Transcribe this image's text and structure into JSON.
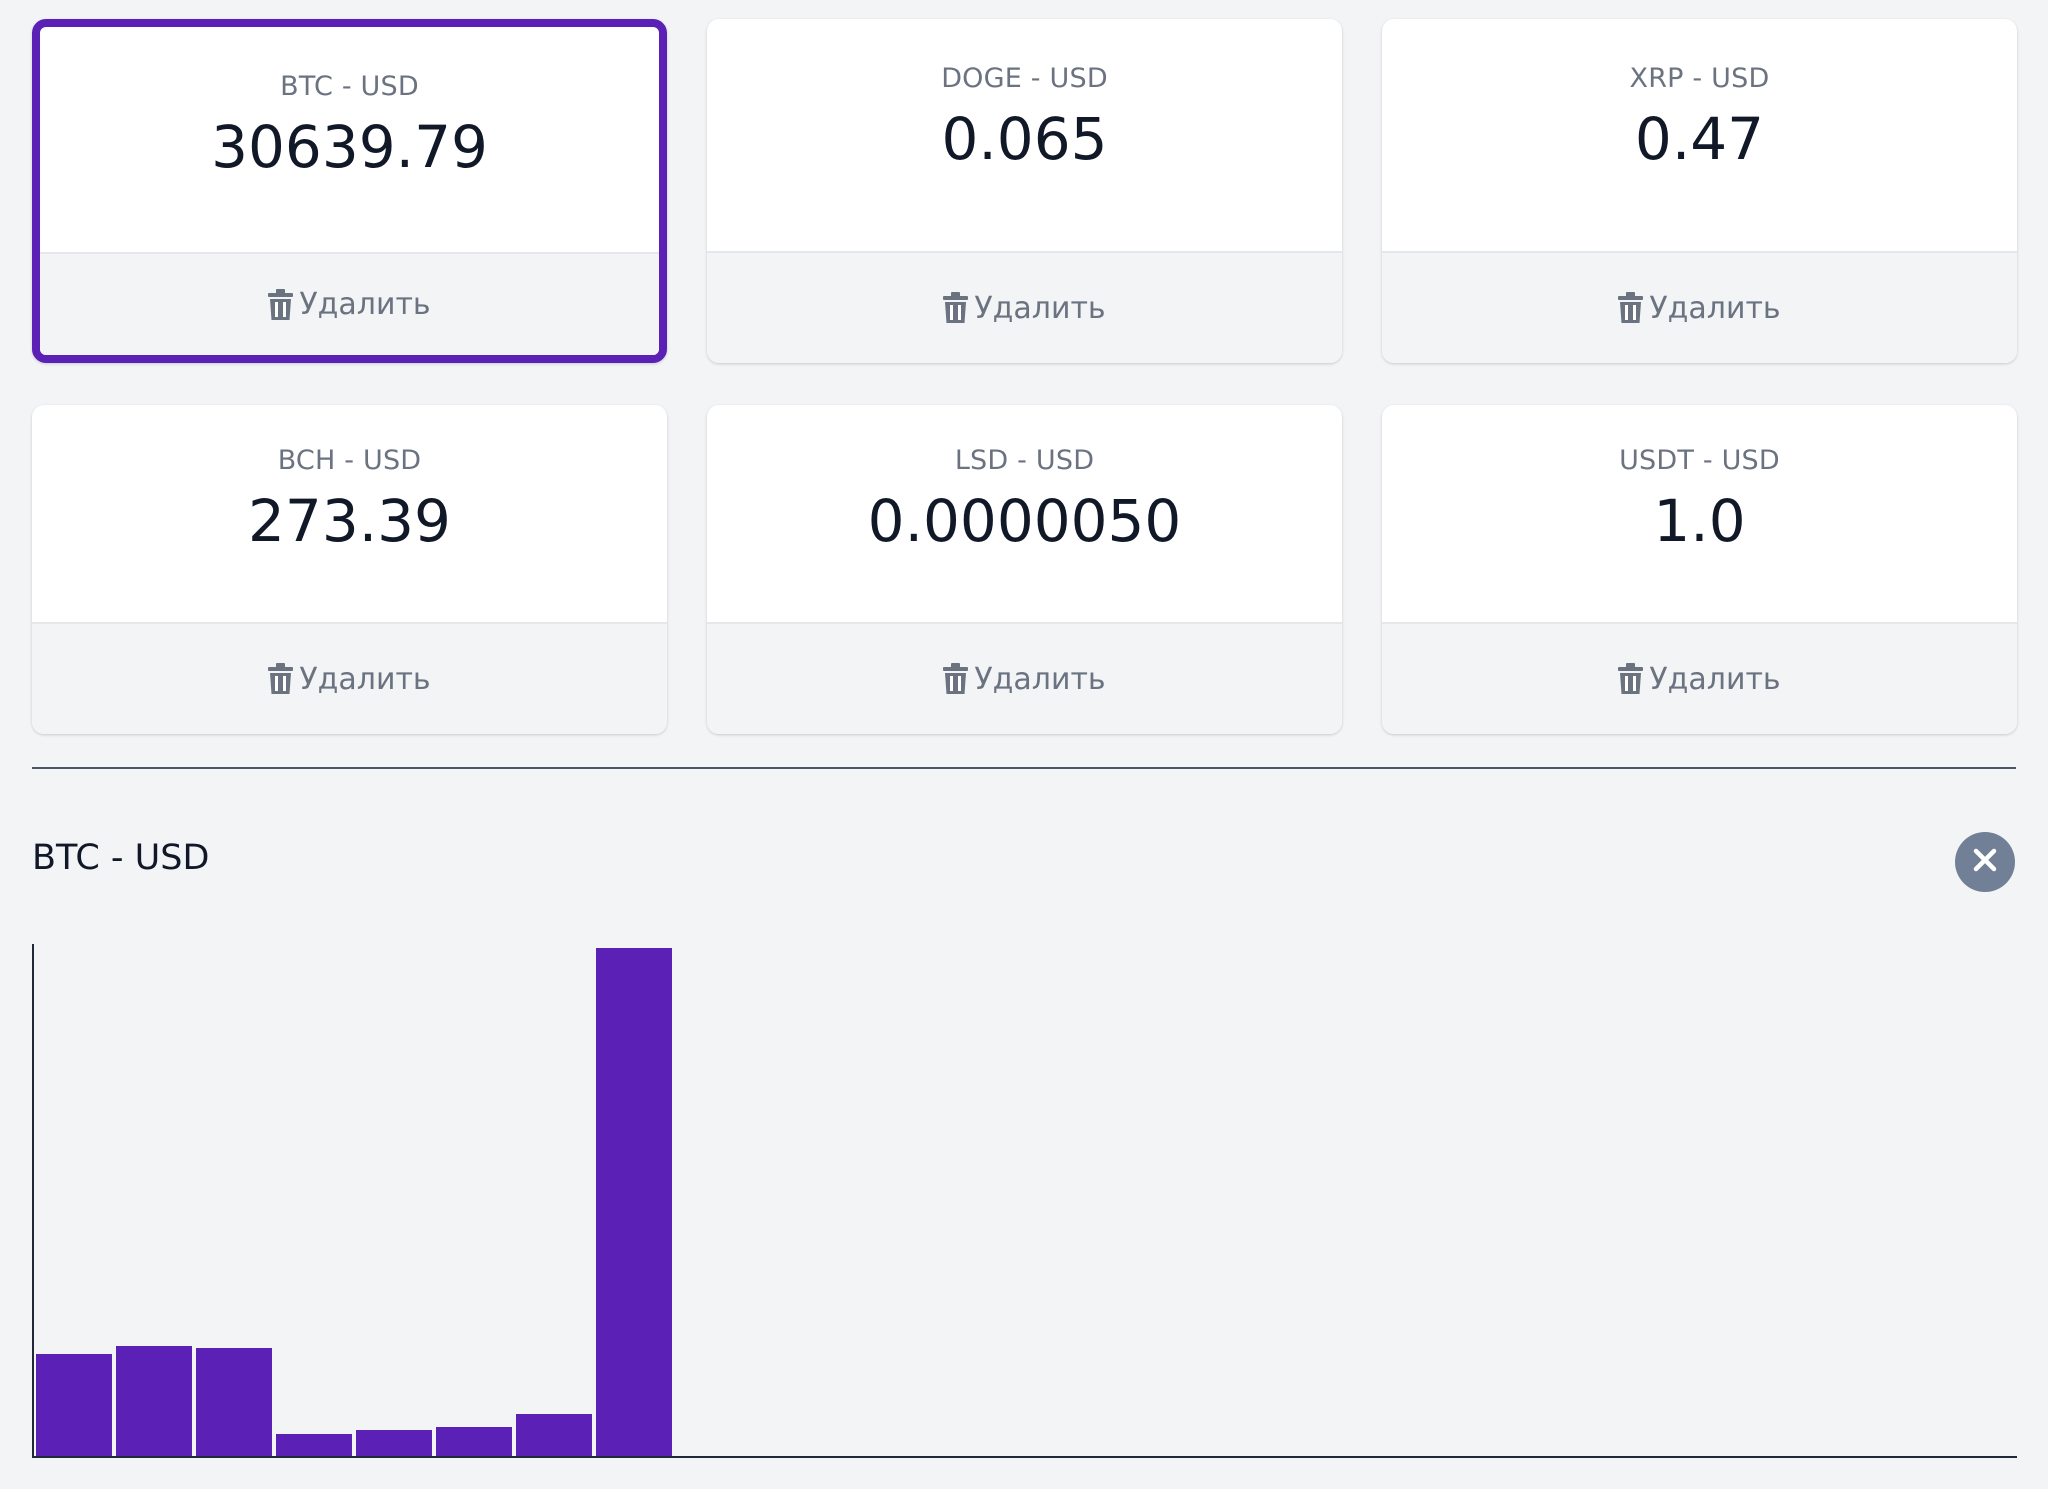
{
  "tickers": [
    {
      "name": "BTC - USD",
      "price": "30639.79",
      "selected": true,
      "delete_label": "Удалить"
    },
    {
      "name": "DOGE - USD",
      "price": "0.065",
      "selected": false,
      "delete_label": "Удалить"
    },
    {
      "name": "XRP - USD",
      "price": "0.47",
      "selected": false,
      "delete_label": "Удалить"
    },
    {
      "name": "BCH - USD",
      "price": "273.39",
      "selected": false,
      "delete_label": "Удалить"
    },
    {
      "name": "LSD - USD",
      "price": "0.0000050",
      "selected": false,
      "delete_label": "Удалить"
    },
    {
      "name": "USDT - USD",
      "price": "1.0",
      "selected": false,
      "delete_label": "Удалить"
    }
  ],
  "graph": {
    "title": "BTC - USD",
    "close_icon": "close-icon"
  },
  "colors": {
    "accent": "#5b21b6",
    "background": "#f3f4f6",
    "card": "#ffffff",
    "muted_text": "#6b7280",
    "close_button": "#718096"
  },
  "chart_data": {
    "type": "bar",
    "title": "BTC - USD",
    "xlabel": "",
    "ylabel": "",
    "grid": false,
    "values_percent_of_max": [
      20,
      21.7,
      21.2,
      4.3,
      5.2,
      5.7,
      8.2,
      100
    ],
    "bar_color": "#5b21b6"
  }
}
